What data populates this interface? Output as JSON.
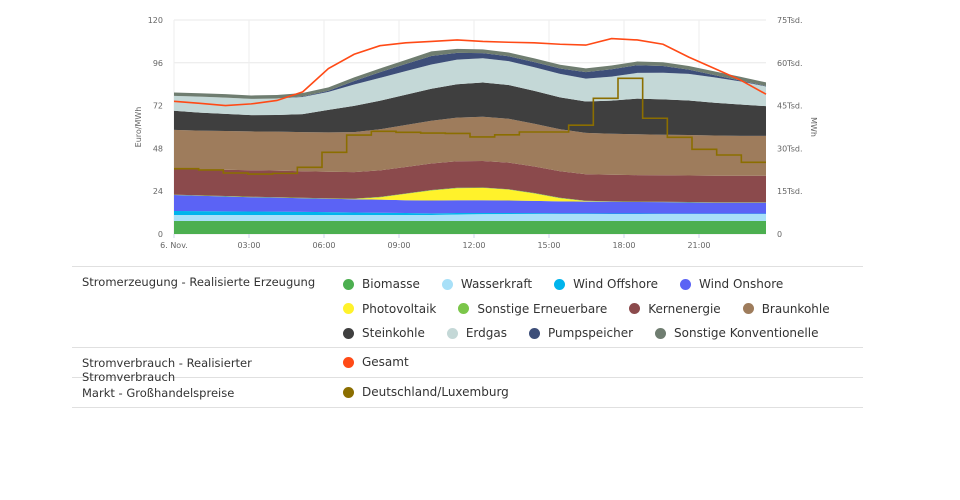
{
  "chart_data": {
    "type": "area",
    "title": "",
    "x": [
      "00:00",
      "01:00",
      "02:00",
      "03:00",
      "04:00",
      "05:00",
      "06:00",
      "07:00",
      "08:00",
      "09:00",
      "10:00",
      "11:00",
      "12:00",
      "13:00",
      "14:00",
      "15:00",
      "16:00",
      "17:00",
      "18:00",
      "19:00",
      "20:00",
      "21:00",
      "22:00",
      "23:00"
    ],
    "x_tick_labels": [
      "6. Nov.",
      "03:00",
      "06:00",
      "09:00",
      "12:00",
      "15:00",
      "18:00",
      "21:00"
    ],
    "y_left": {
      "label": "Euro/MWh",
      "ticks": [
        "0",
        "24",
        "48",
        "72",
        "96",
        "120"
      ],
      "range": [
        0,
        120
      ]
    },
    "y_right": {
      "label": "MWh",
      "ticks": [
        "0",
        "15Tsd.",
        "30Tsd.",
        "45Tsd.",
        "60Tsd.",
        "75Tsd."
      ],
      "range": [
        0,
        75000
      ]
    },
    "grid": true,
    "stacked_series": [
      {
        "name": "Biomasse",
        "color": "#4caf50",
        "values": [
          4550,
          4550,
          4550,
          4550,
          4550,
          4550,
          4550,
          4550,
          4550,
          4550,
          4550,
          4550,
          4550,
          4550,
          4550,
          4550,
          4550,
          4550,
          4550,
          4550,
          4550,
          4550,
          4550,
          4550
        ]
      },
      {
        "name": "Wasserkraft",
        "color": "#a8e0f8",
        "values": [
          2100,
          2100,
          2100,
          2100,
          2100,
          2100,
          2100,
          2100,
          2100,
          2100,
          2100,
          2300,
          2400,
          2450,
          2450,
          2450,
          2450,
          2450,
          2450,
          2450,
          2450,
          2450,
          2450,
          2450
        ]
      },
      {
        "name": "Wind Offshore",
        "color": "#00b4ec",
        "values": [
          1400,
          1350,
          1300,
          1250,
          1200,
          1100,
          1000,
          900,
          800,
          700,
          600,
          500,
          400,
          350,
          300,
          250,
          250,
          200,
          200,
          150,
          150,
          150,
          150,
          150
        ]
      },
      {
        "name": "Wind Onshore",
        "color": "#5b63f5",
        "values": [
          5600,
          5400,
          5200,
          5000,
          4900,
          4800,
          4700,
          4650,
          4600,
          4500,
          4500,
          4500,
          4500,
          4400,
          4300,
          4200,
          4100,
          4100,
          4000,
          4000,
          3900,
          3800,
          3800,
          3800
        ]
      },
      {
        "name": "Photovoltaik",
        "color": "#fff22b",
        "values": [
          0,
          0,
          0,
          0,
          0,
          0,
          0,
          50,
          800,
          2200,
          3500,
          4200,
          4300,
          3800,
          2600,
          1100,
          150,
          0,
          0,
          0,
          0,
          0,
          0,
          0
        ]
      },
      {
        "name": "Sonstige Erneuerbare",
        "color": "#7bc64a",
        "values": [
          150,
          150,
          150,
          150,
          150,
          150,
          150,
          150,
          150,
          150,
          150,
          150,
          150,
          150,
          150,
          150,
          150,
          150,
          150,
          150,
          150,
          150,
          150,
          150
        ]
      },
      {
        "name": "Kernenergie",
        "color": "#8b4a4c",
        "values": [
          9000,
          9100,
          9200,
          9300,
          9300,
          9300,
          9300,
          9300,
          9300,
          9300,
          9300,
          9300,
          9300,
          9300,
          9300,
          9300,
          9300,
          9300,
          9300,
          9300,
          9300,
          9300,
          9300,
          9300
        ]
      },
      {
        "name": "Braunkohle",
        "color": "#9e7c5c",
        "values": [
          13700,
          13600,
          13600,
          13600,
          13700,
          13700,
          13800,
          14000,
          14400,
          14700,
          15000,
          15300,
          15500,
          15400,
          15000,
          14700,
          14500,
          14400,
          14300,
          14200,
          14200,
          14100,
          14000,
          14000
        ]
      },
      {
        "name": "Steinkohle",
        "color": "#3f3f3f",
        "values": [
          6700,
          6300,
          6000,
          5700,
          5800,
          6300,
          7900,
          9200,
          10000,
          10600,
          11200,
          11700,
          12000,
          11800,
          11500,
          11200,
          11000,
          11600,
          12500,
          12400,
          12100,
          11500,
          11000,
          10400
        ]
      },
      {
        "name": "Erdgas",
        "color": "#c4d8d7",
        "values": [
          5200,
          5600,
          5700,
          5700,
          5800,
          6000,
          6300,
          7500,
          8000,
          8300,
          8500,
          8600,
          8500,
          8400,
          8300,
          8200,
          8000,
          8400,
          9000,
          9300,
          9300,
          8900,
          8100,
          6900
        ]
      },
      {
        "name": "Pumpspeicher",
        "color": "#3d4e79",
        "values": [
          0,
          0,
          0,
          0,
          0,
          200,
          400,
          1200,
          2000,
          2500,
          3000,
          2400,
          1800,
          1700,
          1800,
          1900,
          2300,
          2600,
          2700,
          2400,
          1500,
          800,
          300,
          150
        ]
      },
      {
        "name": "Sonstige Konventionelle",
        "color": "#6f7d70",
        "values": [
          1200,
          1200,
          1200,
          1200,
          1200,
          1200,
          1200,
          1300,
          1300,
          1400,
          1600,
          1400,
          1300,
          1300,
          1300,
          1300,
          1300,
          1300,
          1300,
          1300,
          1300,
          1300,
          1300,
          1300
        ]
      }
    ],
    "line_series": [
      {
        "name": "Gesamt",
        "color": "#ff4a16",
        "axis": "right",
        "values": [
          46500,
          45800,
          45000,
          45600,
          46800,
          49800,
          58000,
          63000,
          66000,
          67000,
          67500,
          68000,
          67500,
          67200,
          67000,
          66500,
          66200,
          68500,
          68000,
          66500,
          62000,
          58000,
          54000,
          49000
        ]
      },
      {
        "name": "Deutschland/Luxemburg",
        "color": "#8b6e00",
        "axis": "left",
        "step": true,
        "values": [
          36.6,
          35.9,
          34.2,
          33.6,
          34.0,
          37.4,
          45.8,
          55.5,
          57.6,
          57.0,
          56.6,
          56.4,
          54.4,
          55.6,
          57.2,
          57.2,
          61.0,
          76.1,
          87.3,
          64.9,
          54.2,
          47.5,
          44.3,
          40.2
        ]
      }
    ]
  },
  "legend": {
    "groups": [
      {
        "label": "Stromerzeugung - Realisierte Erzeugung",
        "items": [
          {
            "label": "Biomasse",
            "color": "#4caf50"
          },
          {
            "label": "Wasserkraft",
            "color": "#a8e0f8"
          },
          {
            "label": "Wind Offshore",
            "color": "#00b4ec"
          },
          {
            "label": "Wind Onshore",
            "color": "#5b63f5"
          },
          {
            "label": "Photovoltaik",
            "color": "#fff22b"
          },
          {
            "label": "Sonstige Erneuerbare",
            "color": "#7bc64a"
          },
          {
            "label": "Kernenergie",
            "color": "#8b4a4c"
          },
          {
            "label": "Braunkohle",
            "color": "#9e7c5c"
          },
          {
            "label": "Steinkohle",
            "color": "#3f3f3f"
          },
          {
            "label": "Erdgas",
            "color": "#c4d8d7"
          },
          {
            "label": "Pumpspeicher",
            "color": "#3d4e79"
          },
          {
            "label": "Sonstige Konventionelle",
            "color": "#6f7d70"
          }
        ]
      },
      {
        "label": "Stromverbrauch - Realisierter Stromverbrauch",
        "items": [
          {
            "label": "Gesamt",
            "color": "#ff4a16"
          }
        ]
      },
      {
        "label": "Markt - Großhandelspreise",
        "items": [
          {
            "label": "Deutschland/Luxemburg",
            "color": "#8b6e00"
          }
        ]
      }
    ]
  }
}
